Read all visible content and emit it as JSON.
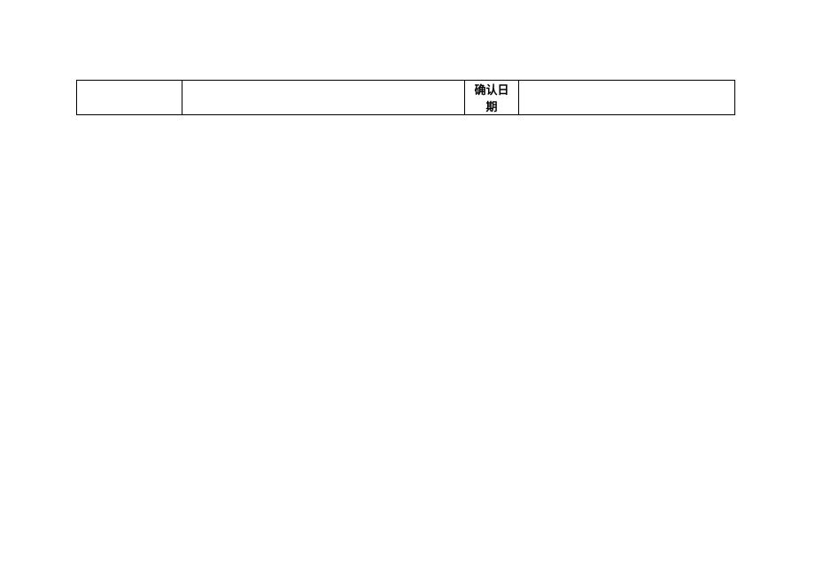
{
  "row": {
    "cell1": "",
    "cell2": "",
    "cell3_label": "确认日期",
    "cell4": ""
  }
}
